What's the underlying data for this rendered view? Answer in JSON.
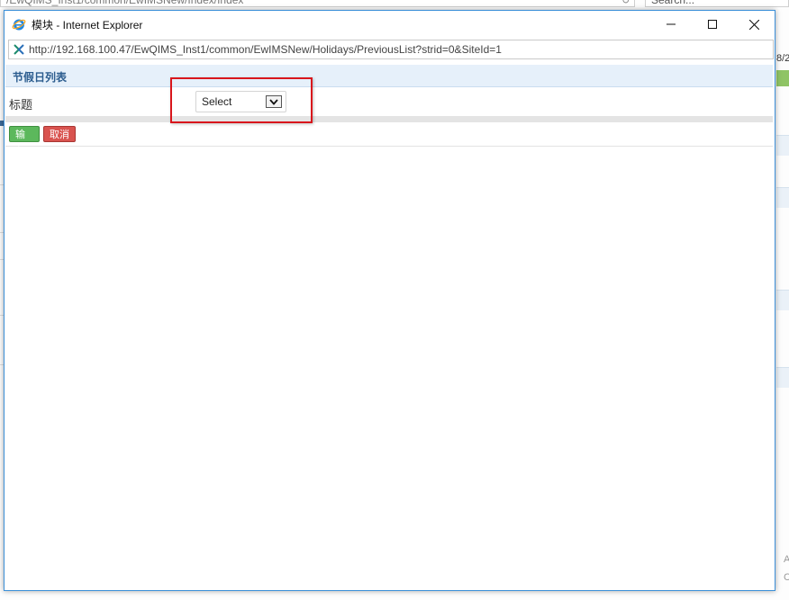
{
  "background": {
    "address_fragment": "/EwQIMS_Inst1/common/EwIMSNew/Index/Index",
    "search_fragment": "Search...",
    "date_fragment": "8/2",
    "side_letter_a": "A",
    "side_letter_c": "C"
  },
  "window": {
    "title": "模块 - Internet Explorer",
    "url": "http://192.168.100.47/EwQIMS_Inst1/common/EwIMSNew/Holidays/PreviousList?strid=0&SiteId=1"
  },
  "panel": {
    "title": "节假日列表",
    "field_label": "标题",
    "select_value": "Select",
    "buttons": {
      "ok": "输入",
      "cancel": "取消"
    }
  },
  "colors": {
    "window_border": "#3b8fd8",
    "header_bg": "#e6f0fa",
    "ok_button": "#5cb85c",
    "cancel_button": "#d9534f",
    "highlight": "#d9161c"
  },
  "icons": {
    "ie": "internet-explorer-icon",
    "site": "site-favicon-icon",
    "dropdown": "chevron-down-icon"
  }
}
